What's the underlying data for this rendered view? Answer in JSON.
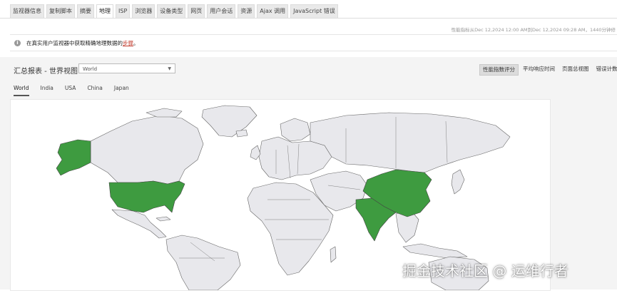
{
  "tabs": [
    "监视器信息",
    "复制脚本",
    "摘要",
    "地理",
    "ISP",
    "浏览器",
    "设备类型",
    "网页",
    "用户会话",
    "资源",
    "Ajax 调用",
    "JavaScript 错误"
  ],
  "active_tab": "地理",
  "range_text": "性能指标从Dec 12,2024 12:00 AM到Dec 12,2024 09:28 AM，1440分钟修",
  "notice": {
    "text": "在真实用户监视器中获取精确地理数据的",
    "link": "步骤",
    "suffix": "。"
  },
  "report": {
    "title": "汇总报表 - 世界视图",
    "select_value": "World"
  },
  "views": [
    "性能指数评分",
    "平均响应时间",
    "页面总视图",
    "错误计数"
  ],
  "active_view": "性能指数评分",
  "map_tabs": [
    "World",
    "India",
    "USA",
    "China",
    "Japan"
  ],
  "active_map_tab": "World",
  "highlighted_countries": [
    "USA",
    "China",
    "India"
  ],
  "colors": {
    "highlight": "#3e9b40",
    "land": "#e8e8ec",
    "border": "#666666"
  },
  "watermark": "掘金技术社区 @ 运维行者"
}
